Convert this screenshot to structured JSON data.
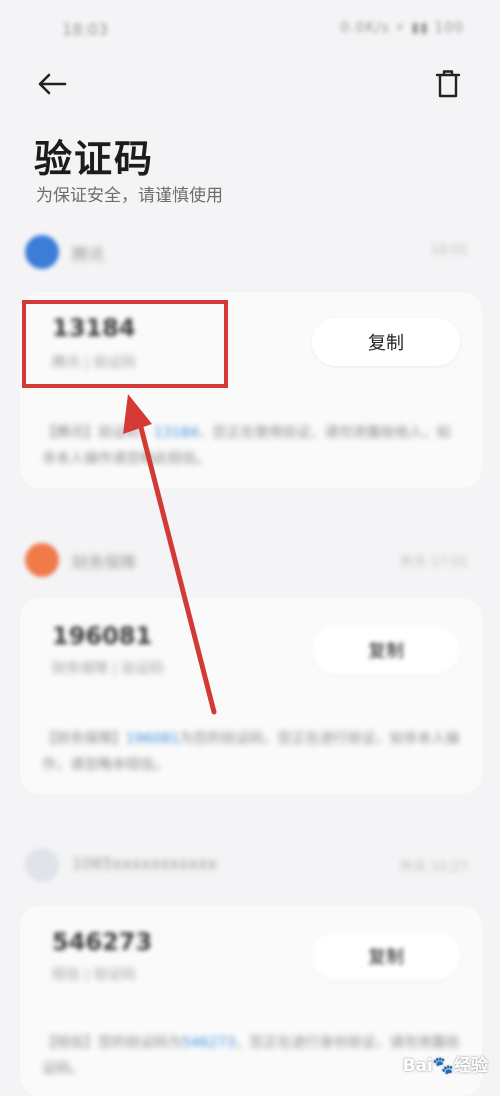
{
  "status_bar": {
    "time": "18:03",
    "icons": "0.0K/s ⚡ ▮▮ 100"
  },
  "header": {
    "back_icon": "arrow-left-icon",
    "trash_icon": "trash-icon"
  },
  "title": "验证码",
  "subtitle": "为保证安全，请谨慎使用",
  "messages": [
    {
      "sender_name": "腾讯",
      "sender_time": "18:01",
      "avatar_color": "#3b7dd8",
      "code": "13184",
      "code_label": "腾讯 | 验证码",
      "copy_label": "复制",
      "text_before": "【腾讯】验证码：",
      "text_code": "13184",
      "text_after": "，您正在使用验证，请勿泄露给他人，如非本人操作请忽略此短信。"
    },
    {
      "sender_name": "财务保障",
      "sender_time": "昨天 17:01",
      "avatar_color": "#f07a4a",
      "code": "196081",
      "code_label": "财务保障 | 验证码",
      "copy_label": "复制",
      "text_before": "【财务保障】",
      "text_code": "196081",
      "text_after": "为您的验证码，您正在进行验证，如非本人操作，请忽略本短信。"
    },
    {
      "sender_name": "1065xxxxxxxxxxx",
      "sender_time": "昨天 10:27",
      "avatar_color": "#dfe3ea",
      "code": "546273",
      "code_label": "短信 | 验证码",
      "copy_label": "复制",
      "text_before": "【短信】您的验证码为",
      "text_code": "546273",
      "text_after": "，您正在进行身份验证，请勿泄露验证码。"
    }
  ],
  "watermark": "Bai🐾经验",
  "colors": {
    "highlight": "#d43a35",
    "link": "#3b8ed8"
  }
}
